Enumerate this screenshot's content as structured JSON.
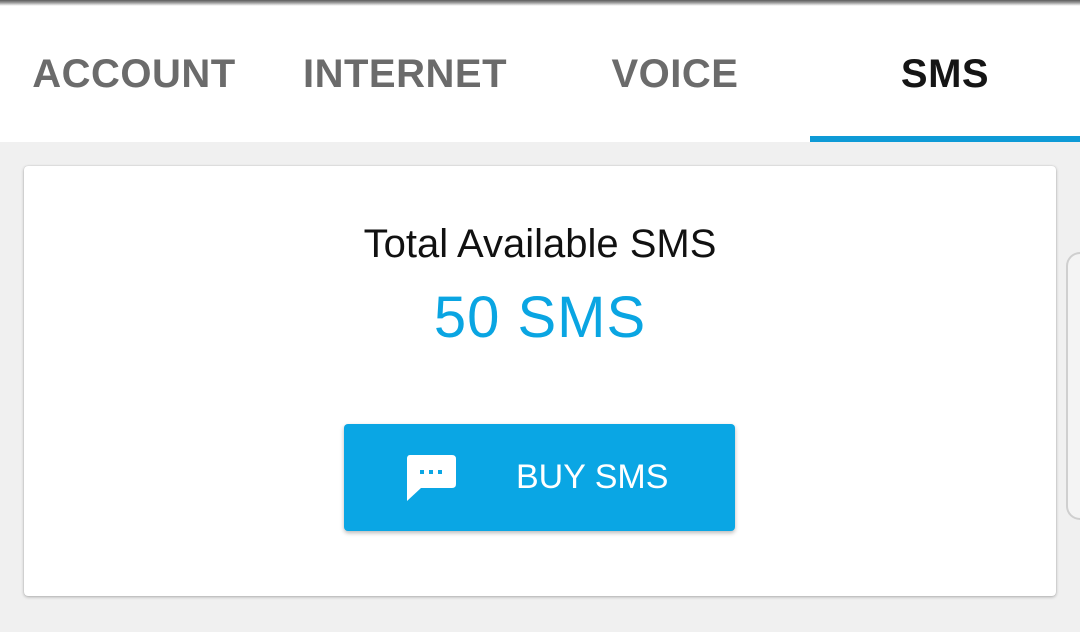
{
  "tabs": [
    {
      "label": "ACCOUNT",
      "active": false
    },
    {
      "label": "INTERNET",
      "active": false
    },
    {
      "label": "VOICE",
      "active": false
    },
    {
      "label": "SMS",
      "active": true
    }
  ],
  "sms_card": {
    "title": "Total Available SMS",
    "value": "50 SMS",
    "buy_button": {
      "label": "BUY SMS",
      "icon": "chat-bubble-icon"
    }
  },
  "colors": {
    "accent": "#0aa6e4",
    "tab_active_text": "#151515",
    "tab_inactive_text": "#6b6b6b",
    "value_text": "#0aa5e2"
  }
}
